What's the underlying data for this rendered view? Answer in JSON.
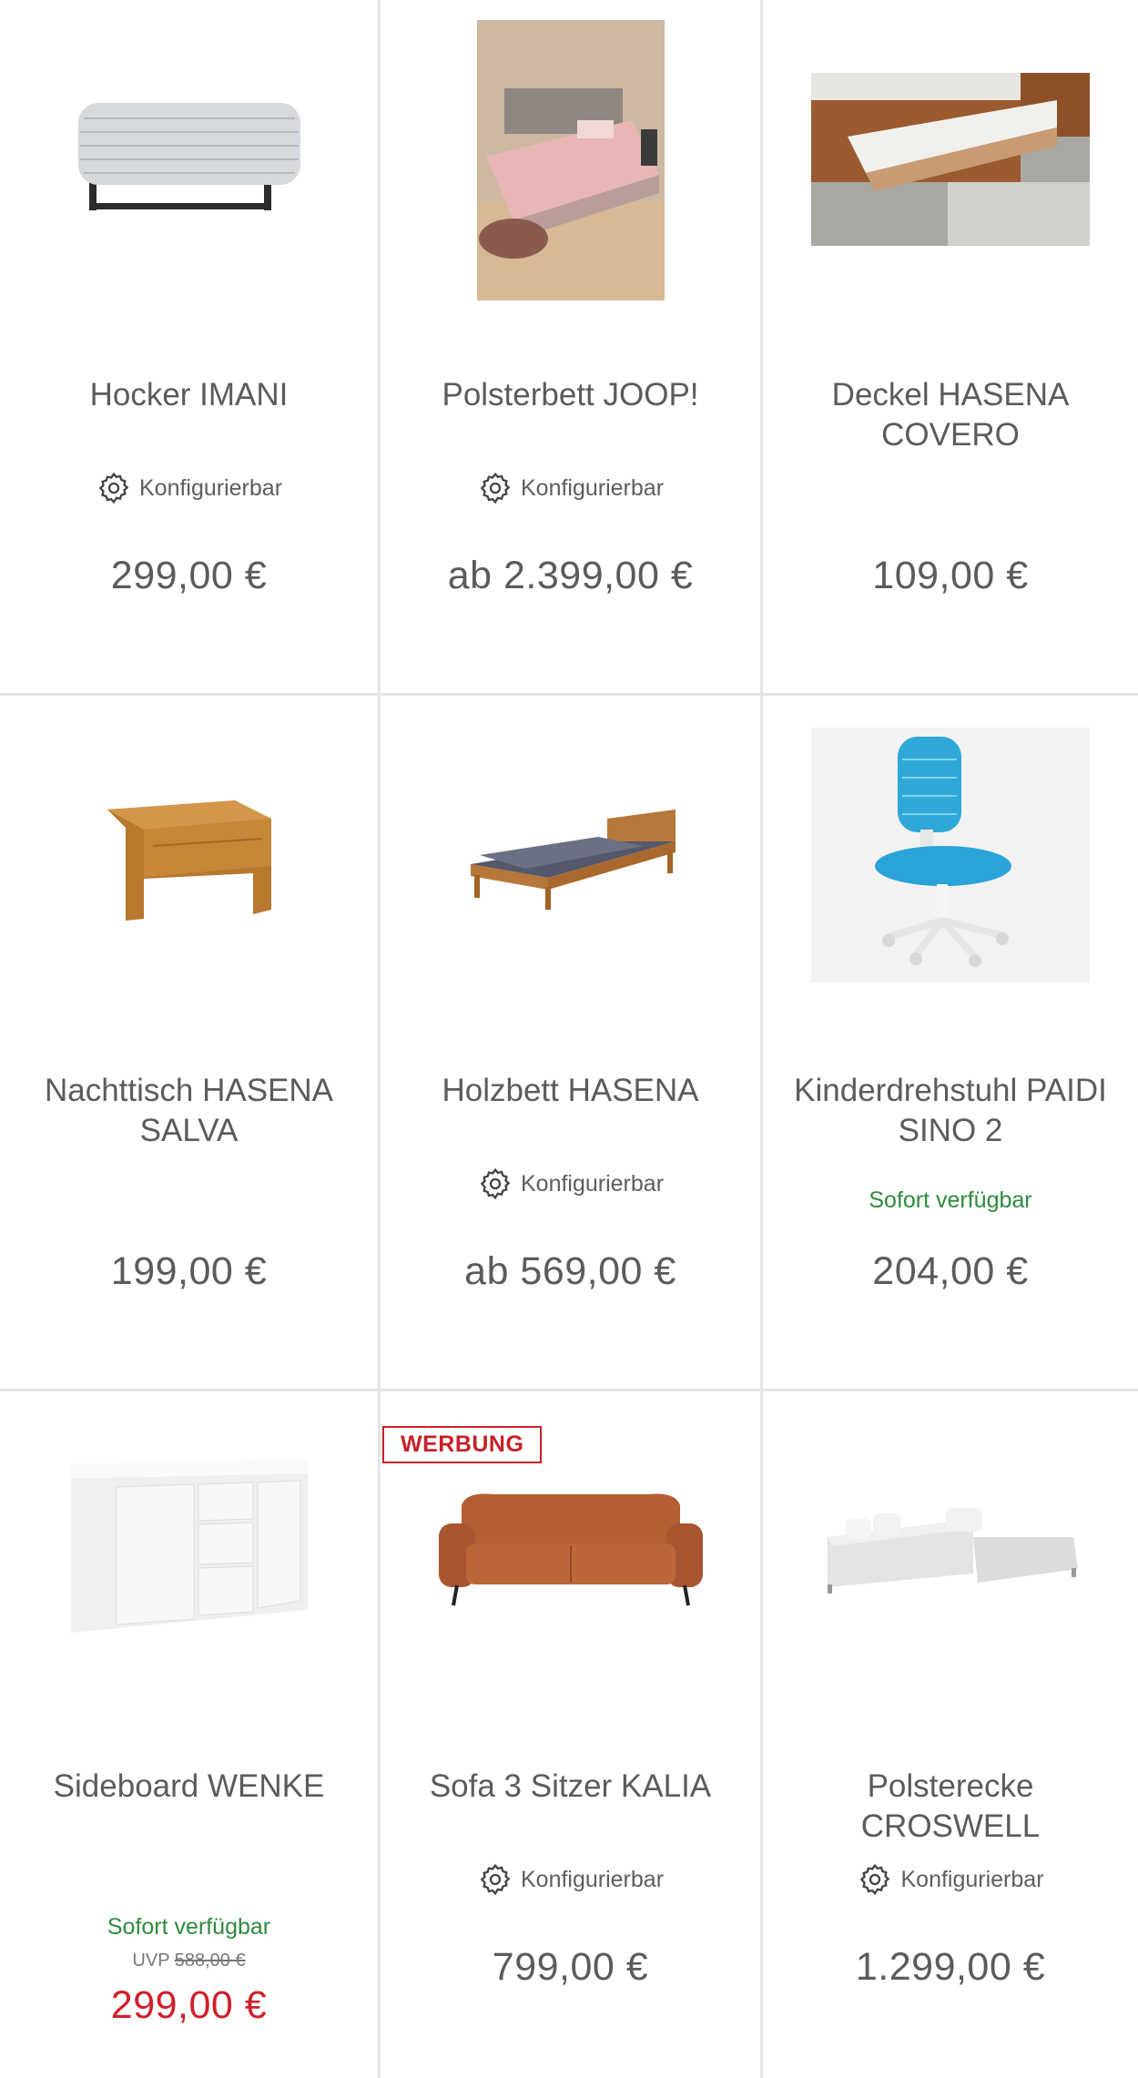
{
  "products": [
    {
      "title": "Hocker IMANI",
      "configurable": "Konfigurierbar",
      "price": "299,00 €"
    },
    {
      "title": "Polsterbett JOOP!",
      "configurable": "Konfigurierbar",
      "price": "ab 2.399,00 €"
    },
    {
      "title": "Deckel HASENA COVERO",
      "price": "109,00 €"
    },
    {
      "title": "Nachttisch HASENA SALVA",
      "price": "199,00 €"
    },
    {
      "title": "Holzbett HASENA",
      "configurable": "Konfigurierbar",
      "price": "ab 569,00 €"
    },
    {
      "title": "Kinderdrehstuhl PAIDI SINO 2",
      "availability": "Sofort verfügbar",
      "price": "204,00 €"
    },
    {
      "title": "Sideboard WENKE",
      "availability": "Sofort verfügbar",
      "uvp_label": "UVP",
      "uvp_price": "588,00 €",
      "price": "299,00 €"
    },
    {
      "title": "Sofa 3 Sitzer KALIA",
      "badge": "WERBUNG",
      "configurable": "Konfigurierbar",
      "price": "799,00 €"
    },
    {
      "title": "Polsterecke CROSWELL",
      "configurable": "Konfigurierbar",
      "price": "1.299,00 €"
    }
  ],
  "colors": {
    "text": "#5b5b5b",
    "available": "#2e8b3d",
    "sale_price": "#d0202b",
    "ad_badge": "#c8202a",
    "divider": "#e6e6e6"
  },
  "icons": {
    "configurable": "gear-icon"
  }
}
